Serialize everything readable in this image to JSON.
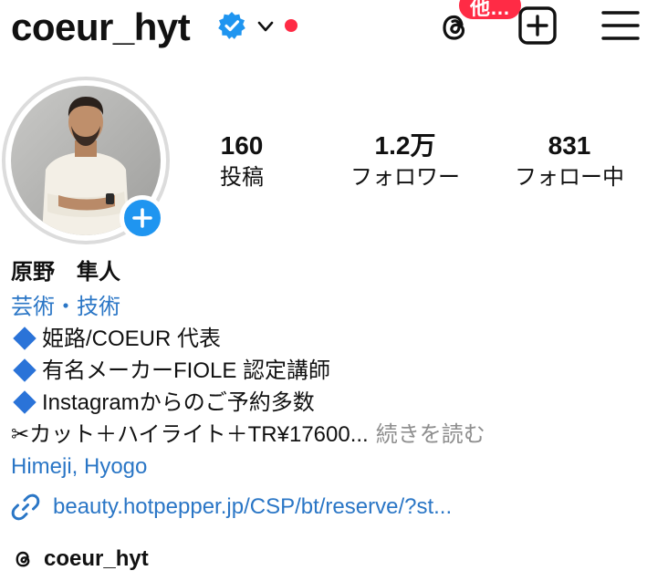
{
  "header": {
    "username": "coeur_hyt",
    "icons": {
      "verified": "verified-badge-icon",
      "account_switch": "chevron-down-icon",
      "threads": "threads-icon",
      "create": "plus-square-icon",
      "menu": "hamburger-menu-icon"
    },
    "notification_badge": "他…"
  },
  "stats": {
    "posts": {
      "value": "160",
      "label": "投稿"
    },
    "followers": {
      "value": "1.2万",
      "label": "フォロワー"
    },
    "following": {
      "value": "831",
      "label": "フォロー中"
    }
  },
  "bio": {
    "display_name": "原野　隼人",
    "category": "芸術・技術",
    "lines": [
      "姫路/COEUR 代表",
      "有名メーカーFIOLE 認定講師",
      "Instagramからのご予約多数"
    ],
    "last_line": "✂カット＋ハイライト＋TR¥17600...",
    "more_label": "続きを読む",
    "location": "Himeji, Hyogo",
    "link": "beauty.hotpepper.jp/CSP/bt/reserve/?st...",
    "threads_handle": "coeur_hyt"
  },
  "colors": {
    "accent_blue": "#1f95f0",
    "link_blue": "#2a76c6",
    "notification_red": "#ff2b45",
    "muted_gray": "#8e8e8e"
  }
}
